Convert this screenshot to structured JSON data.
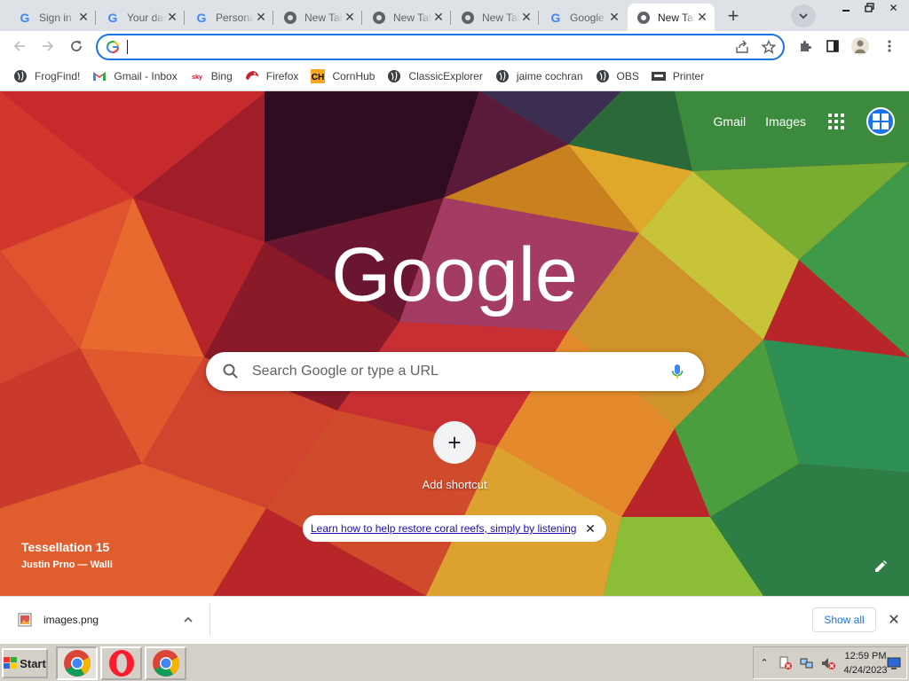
{
  "tabs": [
    {
      "title": "Sign in",
      "icon": "google-g-icon",
      "active": false
    },
    {
      "title": "Your data",
      "icon": "google-g-icon",
      "active": false
    },
    {
      "title": "Personal",
      "icon": "google-g-icon",
      "active": false
    },
    {
      "title": "New Tab",
      "icon": "chrome-icon",
      "active": false
    },
    {
      "title": "New Tab",
      "icon": "chrome-icon",
      "active": false
    },
    {
      "title": "New Tab",
      "icon": "chrome-icon",
      "active": false
    },
    {
      "title": "Google",
      "icon": "google-g-icon",
      "active": false
    },
    {
      "title": "New Tab",
      "icon": "chrome-icon",
      "active": true
    }
  ],
  "omnibox": {
    "value": ""
  },
  "bookmarks": [
    {
      "label": "FrogFind!",
      "icon": "globe-icon"
    },
    {
      "label": "Gmail - Inbox",
      "icon": "gmail-icon"
    },
    {
      "label": "Bing",
      "icon": "sky-icon"
    },
    {
      "label": "Firefox",
      "icon": "firefox-icon"
    },
    {
      "label": "CornHub",
      "icon": "cornhub-icon"
    },
    {
      "label": "ClassicExplorer",
      "icon": "globe-icon"
    },
    {
      "label": "jaime cochran",
      "icon": "globe-icon"
    },
    {
      "label": "OBS",
      "icon": "globe-icon"
    },
    {
      "label": "Printer",
      "icon": "printer-icon"
    }
  ],
  "ntp": {
    "gmail_link": "Gmail",
    "images_link": "Images",
    "logo_text": "Google",
    "search_placeholder": "Search Google or type a URL",
    "add_shortcut": "Add shortcut",
    "promo_text": "Learn how to help restore coral reefs, simply by listening",
    "bg_title": "Tessellation 15",
    "bg_author": "Justin Prno — Walli"
  },
  "downloads": {
    "file_name": "images.png",
    "show_all": "Show all"
  },
  "taskbar": {
    "start_label": "Start",
    "time": "12:59 PM",
    "date": "4/24/2023"
  },
  "colors": {
    "accent": "#1a73e8",
    "tab_strip": "#dee1e6",
    "taskbar": "#d4d0c8"
  }
}
